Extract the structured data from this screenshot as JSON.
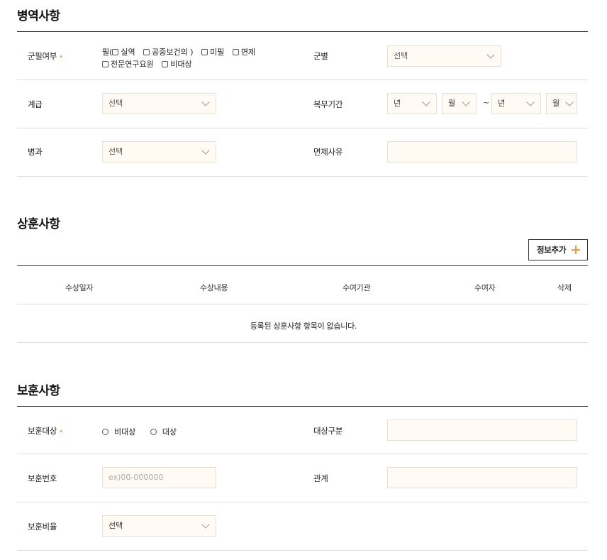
{
  "military": {
    "title": "병역사항",
    "service_status": {
      "label": "군필여부",
      "required_mark": "•",
      "prefix": "필(",
      "options_line1": [
        "실역",
        "공중보건의 )",
        "미필",
        "면제"
      ],
      "options_line2": [
        "전문연구요원",
        "비대상"
      ]
    },
    "branch": {
      "label": "군별",
      "value": "선택"
    },
    "rank": {
      "label": "계급",
      "value": "선택"
    },
    "period": {
      "label": "복무기간",
      "start_year": "년",
      "start_month": "월",
      "separator": "~",
      "end_year": "년",
      "end_month": "월"
    },
    "specialty": {
      "label": "병과",
      "value": "선택"
    },
    "exemption_reason": {
      "label": "면제사유",
      "value": ""
    }
  },
  "awards": {
    "title": "상훈사항",
    "add_button": "정보추가",
    "columns": [
      "수상일자",
      "수상내용",
      "수여기관",
      "수여자",
      "삭제"
    ],
    "empty_message": "등록된 상훈사항 항목이 없습니다."
  },
  "veterans": {
    "title": "보훈사항",
    "target": {
      "label": "보훈대상",
      "required_mark": "•",
      "options": [
        "비대상",
        "대상"
      ]
    },
    "category": {
      "label": "대상구분",
      "value": ""
    },
    "number": {
      "label": "보훈번호",
      "placeholder": "ex)00-000000"
    },
    "relation": {
      "label": "관계",
      "value": ""
    },
    "ratio": {
      "label": "보훈비율",
      "value": "선택"
    }
  }
}
